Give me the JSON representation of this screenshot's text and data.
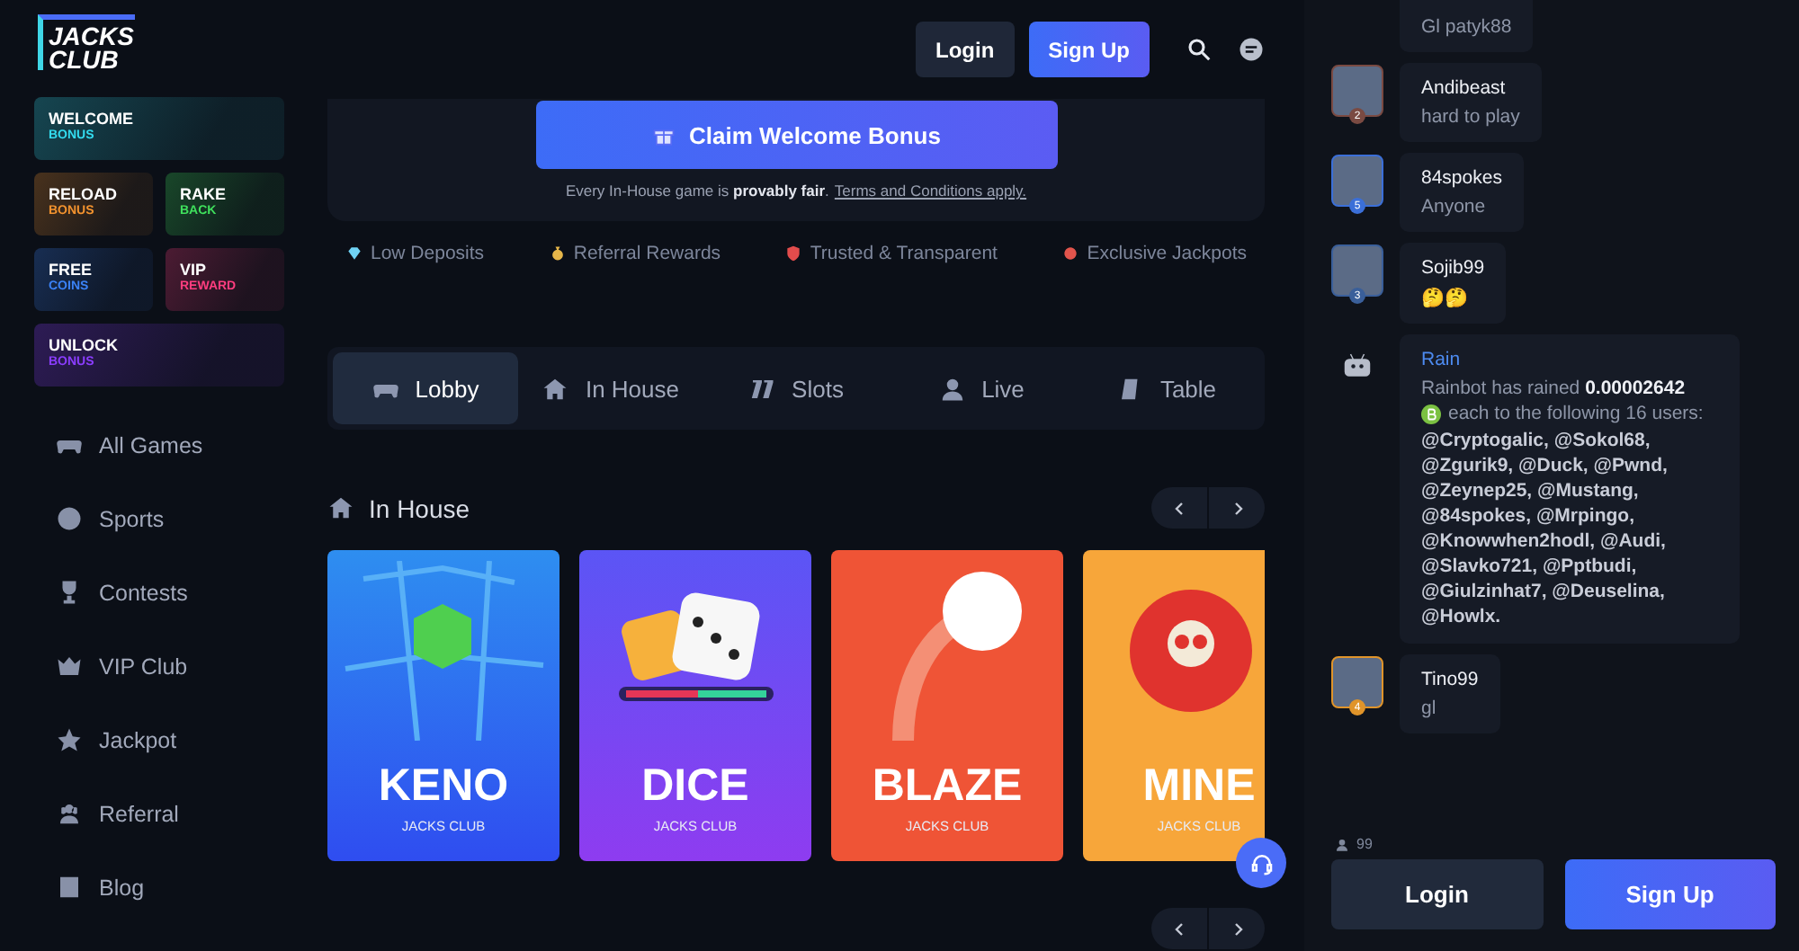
{
  "logo": {
    "line1": "JACKS",
    "line2": "CLUB"
  },
  "promos": [
    {
      "title": "WELCOME",
      "subtitle": "BONUS",
      "color": "#33dcef",
      "kind": "wide"
    },
    {
      "title": "RELOAD",
      "subtitle": "BONUS",
      "color": "#f2922e",
      "kind": "half"
    },
    {
      "title": "RAKE",
      "subtitle": "BACK",
      "color": "#3fe05c",
      "kind": "half"
    },
    {
      "title": "FREE",
      "subtitle": "COINS",
      "color": "#3b82f6",
      "kind": "half"
    },
    {
      "title": "VIP",
      "subtitle": "REWARD",
      "color": "#ff3d7f",
      "kind": "half"
    },
    {
      "title": "UNLOCK",
      "subtitle": "BONUS",
      "color": "#8b3dff",
      "kind": "wide"
    }
  ],
  "nav": [
    {
      "label": "All Games"
    },
    {
      "label": "Sports"
    },
    {
      "label": "Contests"
    },
    {
      "label": "VIP Club"
    },
    {
      "label": "Jackpot"
    },
    {
      "label": "Referral"
    },
    {
      "label": "Blog"
    }
  ],
  "header": {
    "login": "Login",
    "signup": "Sign Up"
  },
  "hero": {
    "button": "Claim Welcome Bonus",
    "note": "Every In-House game is **provably fair**.",
    "link": "Terms and Conditions apply."
  },
  "features": [
    {
      "label": "Low Deposits"
    },
    {
      "label": "Referral Rewards"
    },
    {
      "label": "Trusted & Transparent"
    },
    {
      "label": "Exclusive Jackpots"
    }
  ],
  "tabs": [
    {
      "label": "Lobby",
      "selected": true
    },
    {
      "label": "In House",
      "selected": false
    },
    {
      "label": "Slots",
      "selected": false
    },
    {
      "label": "Live",
      "selected": false
    },
    {
      "label": "Table",
      "selected": false
    }
  ],
  "section": {
    "title": "In House"
  },
  "games": [
    {
      "kind": "keno",
      "title": "KENO",
      "subtitle": "JACKS CLUB",
      "color": "#2e8ef0"
    },
    {
      "kind": "dice",
      "title": "DICE",
      "subtitle": "JACKS CLUB",
      "color": "#5b55f5"
    },
    {
      "kind": "blaze",
      "title": "BLAZE",
      "subtitle": "JACKS CLUB",
      "color": "#ef5436"
    },
    {
      "kind": "mines",
      "title": "MINE",
      "subtitle": "JACKS CLUB",
      "color": "#f7a63a"
    }
  ],
  "chat": {
    "messages": [
      {
        "kind": "cut",
        "text": "Gl patyk88"
      },
      {
        "kind": "user",
        "user": "Andibeast",
        "text": "hard to play",
        "level": "2",
        "color": "#7a4a42"
      },
      {
        "kind": "user",
        "user": "84spokes",
        "text": "Anyone",
        "level": "5",
        "color": "#3b6fd8"
      },
      {
        "kind": "user",
        "user": "Sojib99",
        "text": "🤔🤔",
        "level": "3",
        "color": "#3a5f9a"
      },
      {
        "kind": "rain",
        "user": "Rain",
        "before": "Rainbot has rained **0.00002642**",
        "after": "each to the following 16 users:",
        "mentions": "@Cryptogalic, @Sokol68, @Zgurik9, @Duck, @Pwnd, @Zeynep25, @Mustang, @84spokes, @Mrpingo, @Knowwhen2hodl, @Audi, @Slavko721, @Pptbudi, @Giulzinhat7, @Deuselina, @Howlx."
      },
      {
        "kind": "user",
        "user": "Tino99",
        "text": "gl",
        "level": "4",
        "color": "#e0942a"
      }
    ],
    "online": "99",
    "login": "Login",
    "signup": "Sign Up"
  }
}
